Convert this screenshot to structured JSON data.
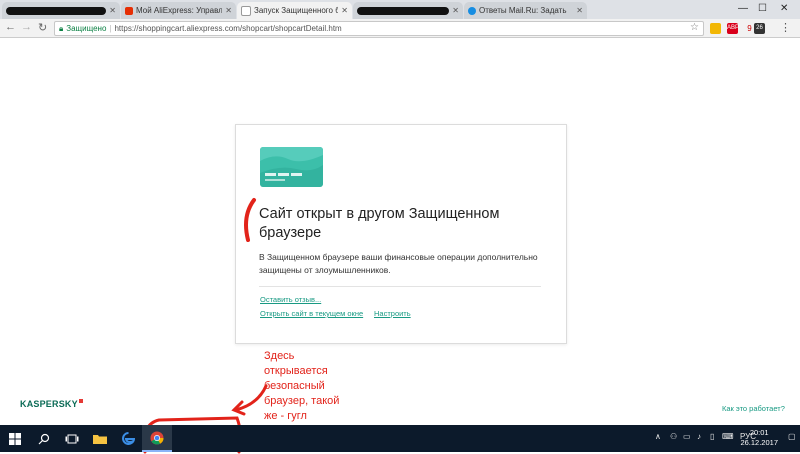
{
  "tabs": [
    {
      "title": "",
      "active": false,
      "redacted": true
    },
    {
      "title": "Мой AliExpress: Управл",
      "active": false
    },
    {
      "title": "Запуск Защищенного б",
      "active": true
    },
    {
      "title": "",
      "active": false,
      "redacted": true
    },
    {
      "title": "Ответы Mail.Ru: Задать",
      "active": false
    }
  ],
  "toolbar": {
    "security_label": "Защищено",
    "url": "https://shoppingcart.aliexpress.com/shopcart/shopcartDetail.htm",
    "extensions": [
      {
        "name": "bookmark-extension-icon",
        "color": "#f2b705",
        "text": ""
      },
      {
        "name": "abp-extension-icon",
        "color": "#d9001b",
        "text": "ABP"
      },
      {
        "name": "extension-icon",
        "color": "#777777",
        "text": "9"
      },
      {
        "name": "extension-badge-icon",
        "color": "#333333",
        "text": "26"
      }
    ]
  },
  "dialog": {
    "title": "Сайт открыт в другом Защищенном браузере",
    "description": "В Защищенном браузере ваши финансовые операции дополнительно защищены от злоумышленников.",
    "feedback_link": "Оставить отзыв...",
    "open_here_link": "Открыть сайт в текущем окне",
    "settings_link": "Настроить"
  },
  "footer": {
    "brand": "KASPERSKY",
    "how_it_works": "Как это работает?"
  },
  "annotation": "Здесь открывается безопасный браузер, такой же - гугл",
  "taskbar": {
    "language": "РУС",
    "time": "20:01",
    "date": "26.12.2017"
  },
  "colors": {
    "accent_green": "#189a83",
    "card_teal": "#3cbfaa",
    "annotation_red": "#e2231a",
    "taskbar": "#0c1a2b"
  }
}
